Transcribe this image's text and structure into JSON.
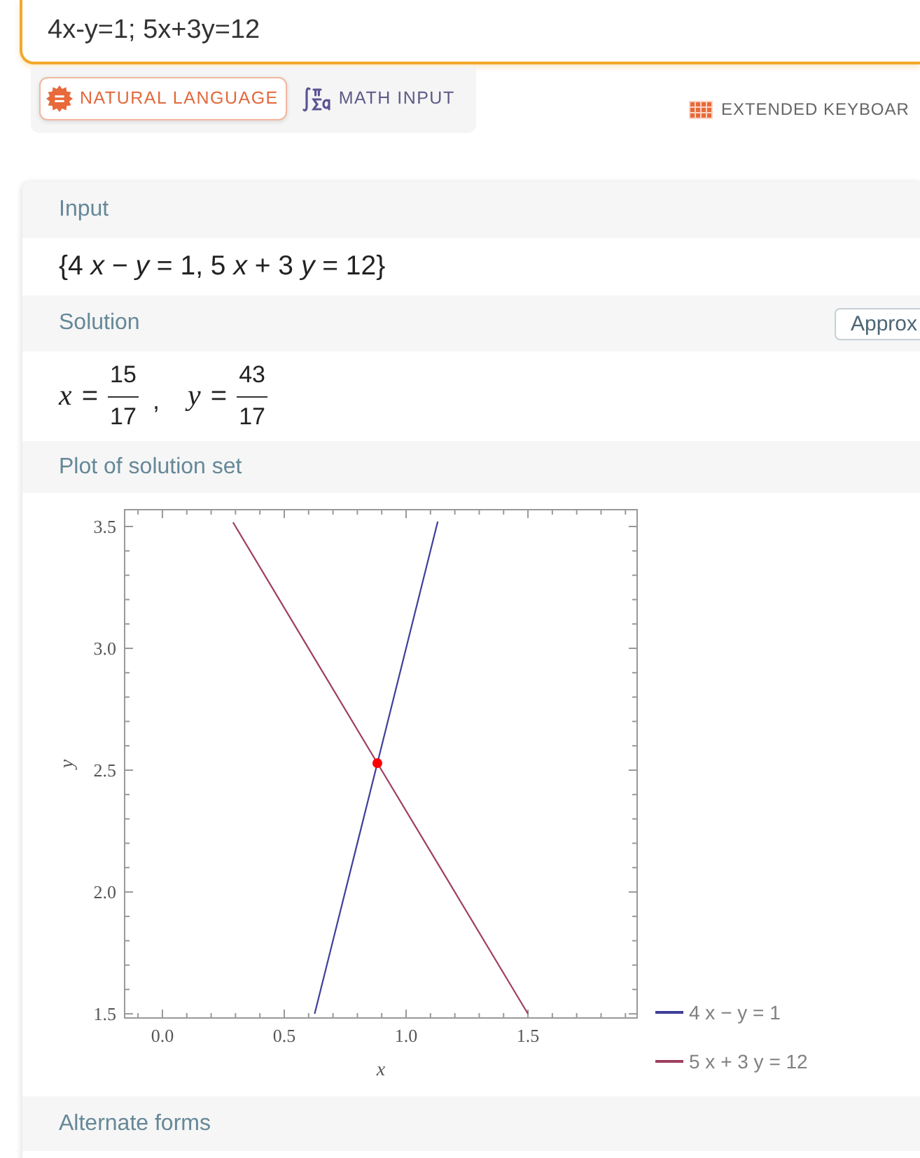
{
  "query": {
    "value": "4x-y=1; 5x+3y=12"
  },
  "input_modes": [
    {
      "kind": "natural",
      "label": "NATURAL LANGUAGE",
      "selected": true
    },
    {
      "kind": "math",
      "label": "MATH INPUT",
      "selected": false
    }
  ],
  "extended_keyboard": {
    "label": "EXTENDED KEYBOAR"
  },
  "pods": [
    {
      "kind": "text",
      "title": "Input",
      "content": "{4 *x* − *y* = 1, 5 *x* + 3 *y* = 12}"
    },
    {
      "kind": "solution",
      "title": "Solution",
      "button": "Approx",
      "separator": ",",
      "equations": [
        {
          "variable": "x",
          "relation": "=",
          "numerator": "15",
          "denominator": "17"
        },
        {
          "variable": "y",
          "relation": "=",
          "numerator": "43",
          "denominator": "17"
        }
      ]
    },
    {
      "kind": "plot",
      "title": "Plot of solution set",
      "chart_data": {
        "type": "line",
        "xlabel": "x",
        "ylabel": "y",
        "x": [
          0.29,
          0.625,
          0.882,
          1.13,
          1.5
        ],
        "series": [
          {
            "name": "4 x − y = 1",
            "color": "#3f3f99",
            "values": [
              null,
              1.5,
              2.529,
              3.52,
              null
            ]
          },
          {
            "name": "5 x + 3 y = 12",
            "color": "#9e3f62",
            "values": [
              3.517,
              2.958,
              2.529,
              2.117,
              1.5
            ]
          }
        ],
        "xlim": [
          -0.155,
          1.948
        ],
        "ylim": [
          1.483,
          3.569
        ],
        "xticks": [
          {
            "value": 0,
            "label": "0.0"
          },
          {
            "value": 0.5,
            "label": "0.5"
          },
          {
            "value": 1,
            "label": "1.0"
          },
          {
            "value": 1.5,
            "label": "1.5"
          }
        ],
        "yticks": [
          {
            "value": 1.5,
            "label": "1.5"
          },
          {
            "value": 2,
            "label": "2.0"
          },
          {
            "value": 2.5,
            "label": "2.5"
          },
          {
            "value": 3,
            "label": "3.0"
          },
          {
            "value": 3.5,
            "label": "3.5"
          }
        ],
        "legend": true
      }
    },
    {
      "kind": "header",
      "title": "Alternate forms"
    }
  ]
}
